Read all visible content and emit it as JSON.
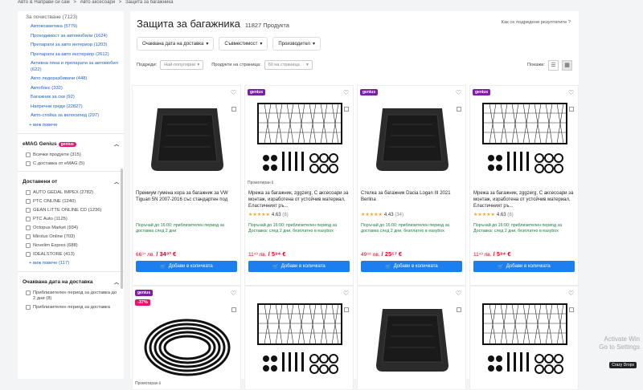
{
  "breadcrumb": [
    "Авто & Направи си сам",
    ">",
    "Авто аксесоари",
    ">",
    "Защита за багажника"
  ],
  "sidebar": {
    "cat_header": "За почистване (7123)",
    "categories": [
      "Автокозметика (5779)",
      "Проходимост за автомобили (1624)",
      "Препарати за авто интериор (1203)",
      "Препарати за авто екстериор (2612)",
      "Активна пяна и препарати за автомобил (622)",
      "Авто ледоразбивачи (448)",
      "Автобокс (332)",
      "Багажник за ски (92)",
      "Напречни греди (22827)",
      "Авто-стойка за велосипед (297)"
    ],
    "more_categories": "+ виж повече",
    "genius": {
      "title": "eMAG Genius",
      "badge": "genius",
      "options": [
        "Всички продукти (315)",
        "С доставка от eMAG (5)"
      ]
    },
    "sellers": {
      "title": "Доставени от",
      "options": [
        "AUTO GEDAL IMPEX (2782)",
        "PTC ONLINE (1240)",
        "GEAN LITTE ONLINE CD (1236)",
        "PTC Auto (1125)",
        "Octopus Market (934)",
        "Mirolux Online (703)",
        "Novelim Expres (688)",
        "IDEALSTORE (413)"
      ],
      "more": "+ виж повече (117)"
    },
    "delivery": {
      "title": "Очаквана дата на доставка",
      "options": [
        "Приблизителен период за доставка до 2 дни (8)",
        "Приблизителен период за доставка"
      ]
    }
  },
  "main": {
    "title": "Защита за багажника",
    "count": "11827 Продукта",
    "sort_info": "Как се подредени резултатите ?",
    "filters": [
      "Очаквана дата на доставка",
      "Съвместимост",
      "Производител"
    ],
    "sort_label": "Подреди:",
    "sort_value": "Най-популярни",
    "per_page_label": "Продукти на страница:",
    "per_page_value": "60 на страница",
    "view_label": "Покажи:"
  },
  "products": [
    {
      "genius": "",
      "discount": "",
      "promo": "",
      "name": "Премиум гумена кора за багажник за VW Tiguan 5N 2007-2016 със стандартен под",
      "stars": "",
      "rating": "",
      "reviews": "",
      "delivery": "Поръчай до 16:00: приблизителен период за доставка след 2 дни",
      "price_old": "66⁹⁷ лв.",
      "price": "34⁹³ €",
      "cart": "Добави в количката",
      "img": "mat"
    },
    {
      "genius": "genius",
      "discount": "",
      "promo": "Промотиран ℹ",
      "name": "Мрежа за багажник, zggzerg, С аксесоари за монтаж, изработена от устойчив материал, Еластичният ръ...",
      "stars": "★★★★★",
      "rating": "4.63",
      "reviews": "(8)",
      "delivery": "Поръчай до 16:00: приблизителен период за Доставка: след 2 дни, безплатно в easybox",
      "price_old": "11⁴³ лв.",
      "price": "5⁸⁴ €",
      "cart": "Добави в количката",
      "img": "net"
    },
    {
      "genius": "genius",
      "discount": "",
      "promo": "",
      "name": "Стелка за багажник Dacia Logan III 2021 Berlina",
      "stars": "★★★★★",
      "rating": "4.43",
      "reviews": "(34)",
      "delivery": "Поръчай до 16:00: приблизителен период за доставка след 2 дни, безплатно в easybox",
      "price_old": "49⁸⁸ лв.",
      "price": "25⁵⁷ €",
      "cart": "Добави в количката",
      "img": "mat"
    },
    {
      "genius": "genius",
      "discount": "",
      "promo": "",
      "name": "Мрежа за багажник, zggzerg, С аксесоари за монтаж, изработена от устойчив материал, Еластичният ръ...",
      "stars": "★★★★★",
      "rating": "4.63",
      "reviews": "(8)",
      "delivery": "Поръчай до 16:00: приблизителен период за Доставка: след 2 дни, безплатно в easybox",
      "price_old": "11⁴³ лв.",
      "price": "5⁸⁴ €",
      "cart": "Добави в количката",
      "img": "net"
    },
    {
      "genius": "genius",
      "discount": "-37%",
      "promo": "Промотиран ℹ",
      "name": "",
      "stars": "",
      "rating": "",
      "reviews": "",
      "delivery": "",
      "price_old": "",
      "price": "",
      "cart": "",
      "img": "coil"
    },
    {
      "genius": "",
      "discount": "",
      "promo": "",
      "name": "",
      "stars": "",
      "rating": "",
      "reviews": "",
      "delivery": "",
      "price_old": "",
      "price": "",
      "cart": "",
      "img": "net"
    },
    {
      "genius": "",
      "discount": "",
      "promo": "",
      "name": "",
      "stars": "",
      "rating": "",
      "reviews": "",
      "delivery": "",
      "price_old": "",
      "price": "",
      "cart": "",
      "img": "mat"
    },
    {
      "genius": "",
      "discount": "",
      "promo": "",
      "name": "",
      "stars": "",
      "rating": "",
      "reviews": "",
      "delivery": "",
      "price_old": "",
      "price": "",
      "cart": "",
      "img": "net"
    }
  ],
  "overlay": {
    "watermark_line1": "Activate Win",
    "watermark_line2": "Go to Settings",
    "badge": "Crazy Drops"
  }
}
